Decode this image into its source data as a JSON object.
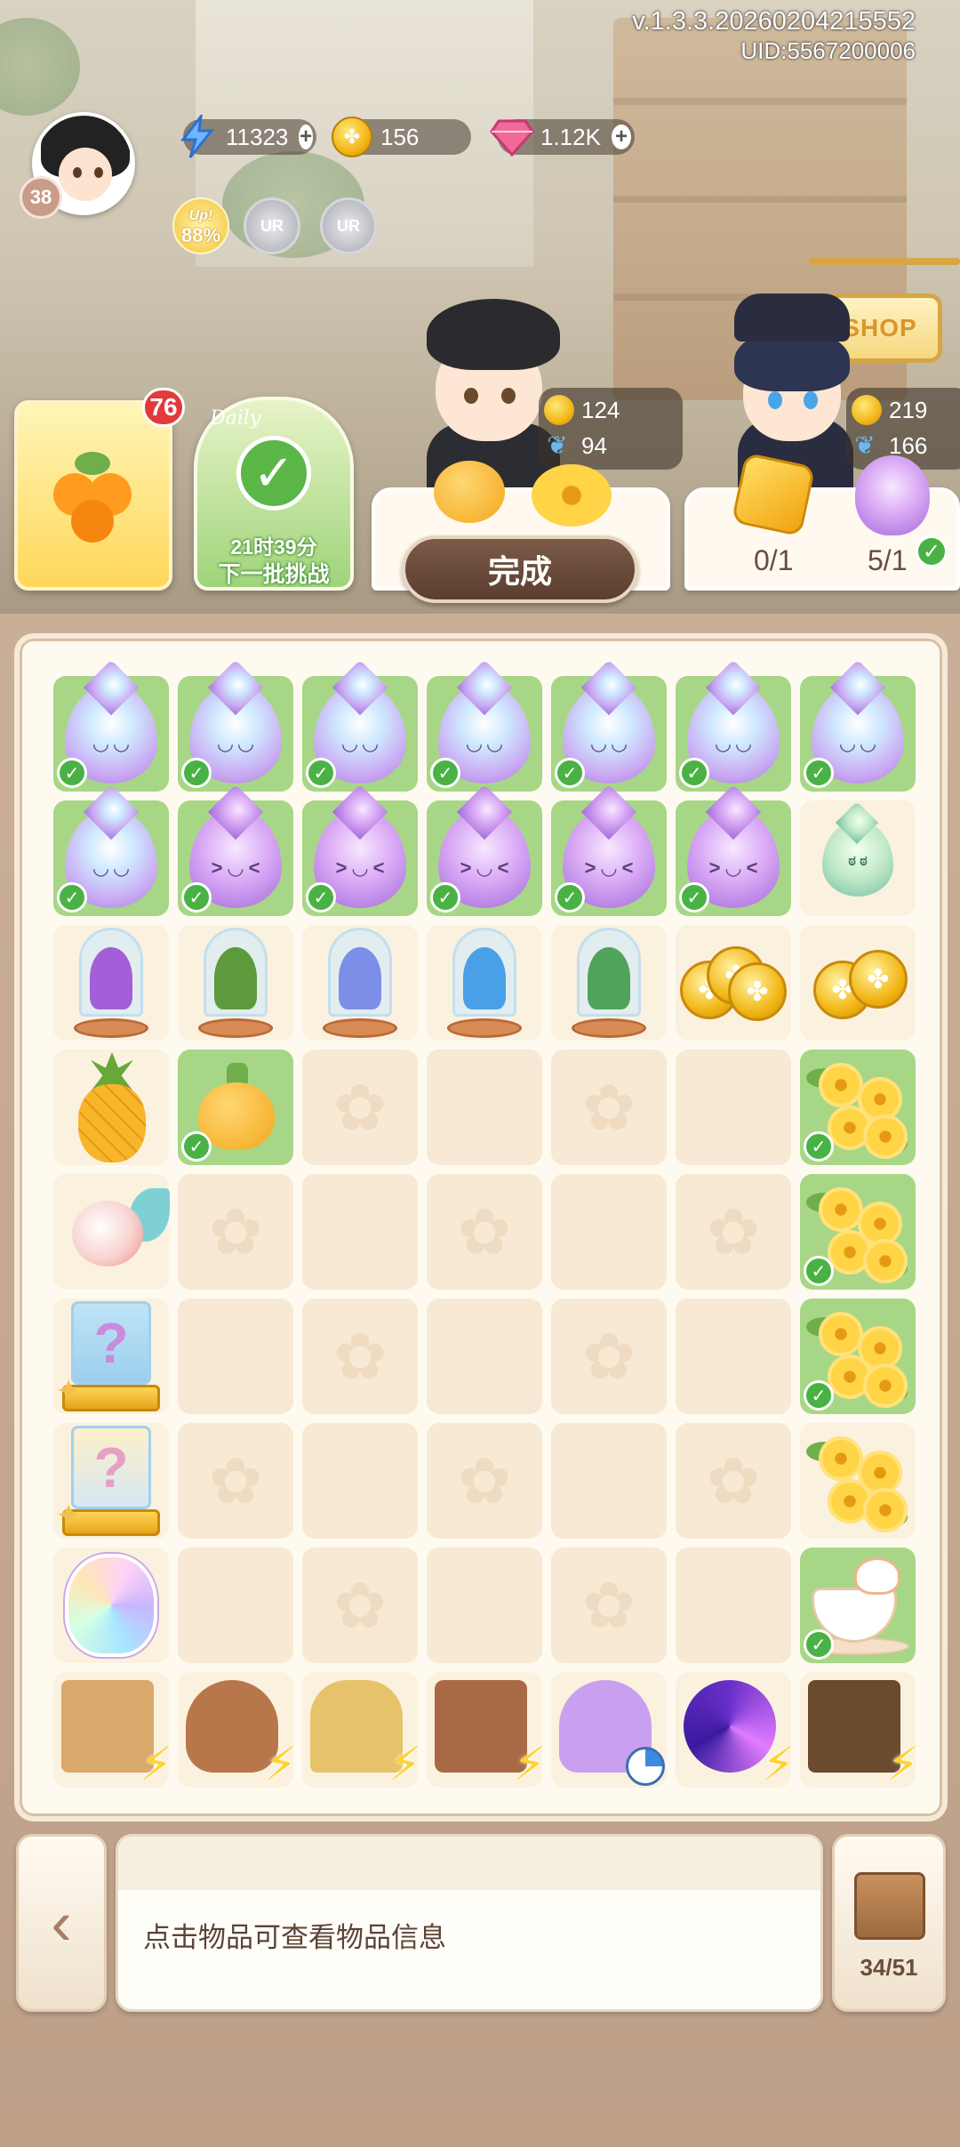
{
  "header": {
    "version": "v.1.3.3.20260204215552",
    "uid": "UID:5567200006",
    "player_level": "38"
  },
  "resources": {
    "energy": "11323",
    "coins": "156",
    "gems": "1.12K"
  },
  "boosts": {
    "up_label": "Up!",
    "up_percent": "88%",
    "ur1": "UR",
    "ur2": "UR"
  },
  "shop_sign": "SHOP",
  "orders": {
    "badge_count": "76",
    "daily_label": "Daily",
    "daily_timer": "21时39分",
    "daily_next": "下一批挑战"
  },
  "characters": [
    {
      "coin_reward": "124",
      "butterfly_reward": "94"
    },
    {
      "coin_reward": "219",
      "butterfly_reward": "166",
      "req1_progress": "0/1",
      "req2_progress": "5/1"
    }
  ],
  "done_button": "完成",
  "board": {
    "rows": [
      [
        "drop-blue-check",
        "drop-blue-check",
        "drop-blue-check",
        "drop-blue-check",
        "drop-blue-check",
        "drop-blue-check",
        "drop-blue-check"
      ],
      [
        "drop-blue-check",
        "drop-purple-check",
        "drop-purple-check",
        "drop-purple-check",
        "drop-purple-check",
        "drop-purple-check",
        "drop-teal"
      ],
      [
        "jar-purple",
        "jar-tree",
        "jar-lavender",
        "jar-blue",
        "jar-vine",
        "coins-big",
        "coins-small"
      ],
      [
        "pineapple",
        "pepper-check",
        "empty-flower",
        "empty",
        "empty-flower",
        "empty",
        "flowers-check"
      ],
      [
        "fish",
        "empty-flower",
        "empty",
        "empty-flower",
        "empty",
        "empty-flower",
        "flowers-check"
      ],
      [
        "mystery-blue",
        "empty",
        "empty-flower",
        "empty",
        "empty-flower",
        "empty",
        "flowers-check"
      ],
      [
        "mystery-gold",
        "empty-flower",
        "empty",
        "empty-flower",
        "empty",
        "empty-flower",
        "flowers-branch"
      ],
      [
        "crystal",
        "empty",
        "empty-flower",
        "empty",
        "empty-flower",
        "empty",
        "teacup-check"
      ],
      [
        "gen-shelf",
        "gen-teapot",
        "gen-house",
        "gen-garden",
        "gen-perfume",
        "gen-vortex",
        "gen-chest"
      ]
    ]
  },
  "bottom": {
    "info_text": "点击物品可查看物品信息",
    "bag_count": "34/51"
  },
  "colors": {
    "accent_green": "#a7d786",
    "check_green": "#4ab245",
    "badge_red": "#e5383b",
    "done_button": "#5a3e30"
  }
}
